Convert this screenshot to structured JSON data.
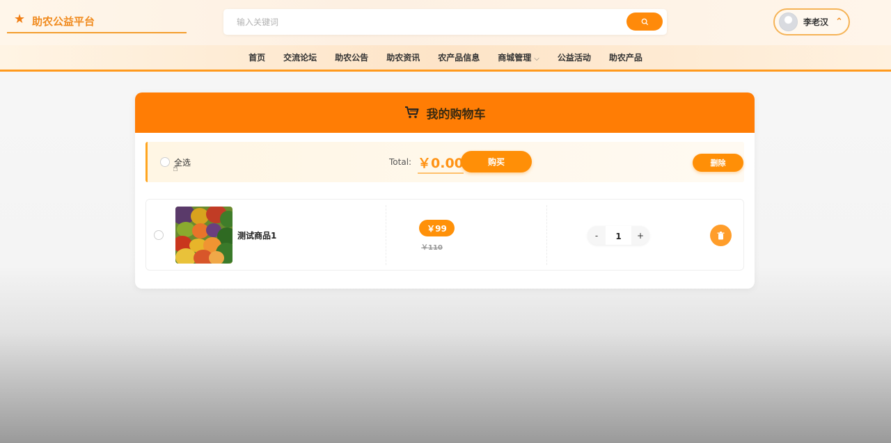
{
  "header": {
    "logo_text": "助农公益平台",
    "search_placeholder": "输入关键词",
    "user_name": "李老汉"
  },
  "nav": {
    "items": [
      "首页",
      "交流论坛",
      "助农公告",
      "助农资讯",
      "农产品信息",
      "商城管理",
      "公益活动",
      "助农产品"
    ]
  },
  "cart": {
    "title": "我的购物车",
    "select_all": "全选",
    "total_label": "Total:",
    "total_value": "￥0.00",
    "buy_label": "购买",
    "delete_label": "删除",
    "items": [
      {
        "name": "测试商品1",
        "price": "￥99",
        "original_price": "￥110",
        "quantity": "1",
        "minus": "-",
        "plus": "+"
      }
    ]
  },
  "colors": {
    "accent": "#ff7d05",
    "button": "#ff8f07"
  }
}
